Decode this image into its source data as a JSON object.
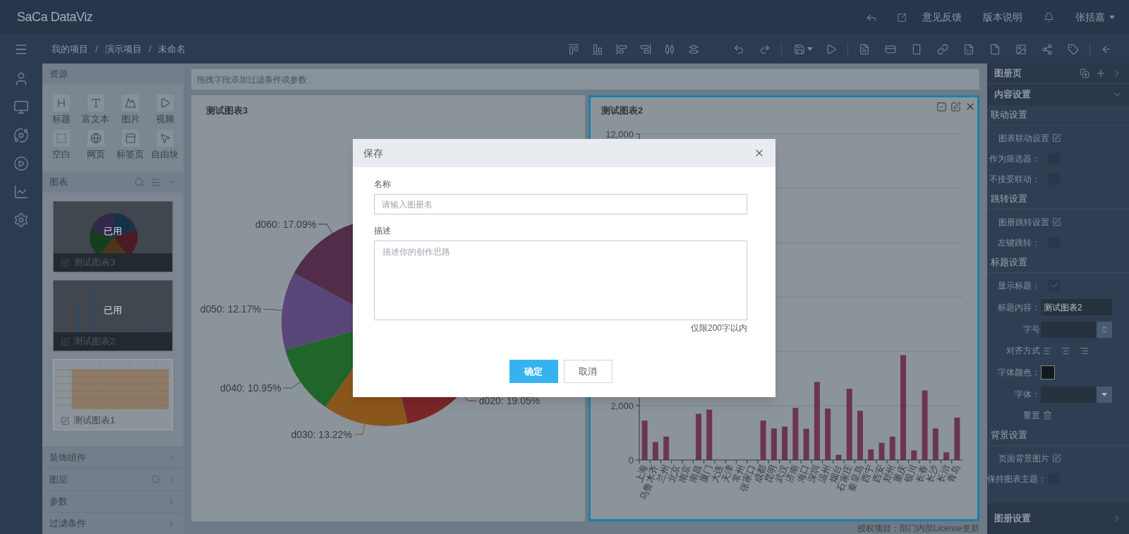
{
  "app": {
    "logo": "SaCa DataViz",
    "header_links": [
      "意见反馈",
      "版本说明"
    ],
    "user": "张括嘉"
  },
  "breadcrumb": {
    "items": [
      "我的项目",
      "演示项目",
      "未命名"
    ],
    "separator": "/"
  },
  "resources": {
    "title": "资源",
    "items": [
      {
        "label": "标题",
        "kind": "heading"
      },
      {
        "label": "富文本",
        "kind": "text"
      },
      {
        "label": "图片",
        "kind": "image"
      },
      {
        "label": "视频",
        "kind": "video"
      },
      {
        "label": "空白",
        "kind": "blank"
      },
      {
        "label": "网页",
        "kind": "web"
      },
      {
        "label": "标签页",
        "kind": "tab"
      },
      {
        "label": "自由块",
        "kind": "block"
      }
    ]
  },
  "charts_panel": {
    "title": "图表",
    "thumbnails": [
      {
        "title": "测试图表3",
        "kind": "pie",
        "used": true,
        "badge": "已用"
      },
      {
        "title": "测试图表2",
        "kind": "bar",
        "used": true,
        "badge": "已用"
      },
      {
        "title": "测试图表1",
        "kind": "table",
        "used": false
      }
    ]
  },
  "panel_sections": [
    {
      "title": "装饰组件",
      "search": false
    },
    {
      "title": "图层",
      "search": true
    },
    {
      "title": "参数",
      "search": false
    },
    {
      "title": "过滤条件",
      "search": false
    }
  ],
  "filter_bar": {
    "hint": "拖拽字段添加过滤条件或参数"
  },
  "pie_card": {
    "chart_data": {
      "type": "pie",
      "title": "测试图表3",
      "values": [
        19.05,
        13.22,
        10.95,
        12.17,
        17.09
      ],
      "value_labels": [
        "d020: 19.05%",
        "d030: 13.22%",
        "d040: 10.95%",
        "d050: 12.17%",
        "d060: 17.09%"
      ]
    }
  },
  "bar_card": {
    "selected": true,
    "chart_data": {
      "type": "bar",
      "title": "测试图表2",
      "categories": [
        "上海",
        "乌鲁木齐",
        "兰州",
        "北京",
        "南京",
        "南昌",
        "厦门",
        "大连",
        "天津",
        "常州",
        "张家口",
        "成都",
        "昆明",
        "武汉",
        "济南",
        "海口",
        "深圳",
        "温州",
        "烟台",
        "石家庄",
        "秦皇岛",
        "西宁",
        "西安",
        "郑州",
        "重庆",
        "银川",
        "长春",
        "长沙",
        "长治",
        "青岛"
      ],
      "series": [
        {
          "color": "#6b3550",
          "values": [
            1450,
            660,
            860,
            null,
            null,
            1700,
            1850,
            null,
            null,
            null,
            null,
            1450,
            1160,
            1230,
            1920,
            1150,
            2870,
            1890,
            190,
            2620,
            1810,
            390,
            630,
            860,
            3860,
            350,
            2560,
            1160,
            280,
            1560
          ]
        }
      ],
      "ylim": [
        0,
        12000
      ],
      "yticks": [
        {
          "value": 0,
          "label": "0"
        },
        {
          "value": 2000,
          "label": "2,000"
        },
        {
          "value": 12000,
          "label": "12,000"
        }
      ]
    }
  },
  "license_note": "授权项目：部门内部License更新",
  "settings_panel": {
    "title": "图册页",
    "content_header": "内容设置",
    "groups": [
      {
        "title": "联动设置",
        "rows": [
          {
            "kind": "link",
            "label": "图表联动设置"
          },
          {
            "kind": "checkbox",
            "label": "作为筛选器：",
            "checked": false
          },
          {
            "kind": "checkbox",
            "label": "不接受联动：",
            "checked": false
          }
        ]
      },
      {
        "title": "跳转设置",
        "rows": [
          {
            "kind": "link",
            "label": "图册跳转设置"
          },
          {
            "kind": "checkbox",
            "label": "左键跳转：",
            "checked": false
          }
        ]
      },
      {
        "title": "标题设置",
        "rows": [
          {
            "kind": "checkbox",
            "label": "显示标题：",
            "checked": true
          },
          {
            "kind": "text",
            "label": "标题内容：",
            "value": "测试图表2"
          },
          {
            "kind": "number",
            "label": "字号"
          },
          {
            "kind": "align",
            "label": "对齐方式"
          },
          {
            "kind": "color",
            "label": "字体颜色：",
            "color": "#111a22"
          },
          {
            "kind": "select",
            "label": "字体："
          },
          {
            "kind": "reset",
            "label": "重置"
          }
        ]
      },
      {
        "title": "背景设置",
        "rows": [
          {
            "kind": "link",
            "label": "页面背景图片"
          },
          {
            "kind": "checkbox",
            "label": "保持图表主题：",
            "checked": false
          }
        ]
      }
    ],
    "footer": "图册设置"
  },
  "dialog": {
    "title": "保存",
    "fields": [
      {
        "kind": "input",
        "label": "名称",
        "placeholder": "请输入图册名"
      },
      {
        "kind": "textarea",
        "label": "描述",
        "placeholder": "描述你的创作思路",
        "hint": "仅限200字以内"
      }
    ],
    "buttons": [
      {
        "label": "确定",
        "primary": true
      },
      {
        "label": "取消",
        "primary": false
      }
    ]
  }
}
